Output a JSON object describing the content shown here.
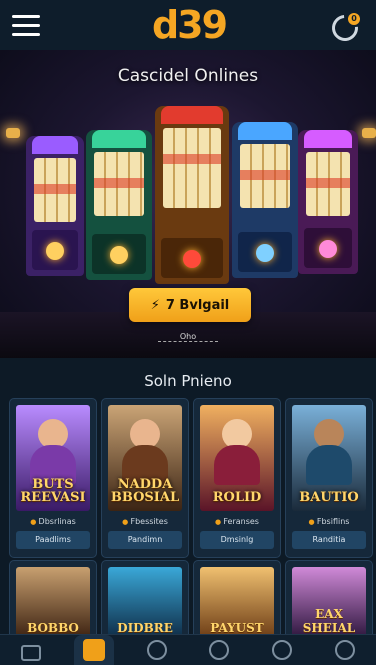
{
  "header": {
    "logo": "d39",
    "refresh_badge": "0",
    "menu_icon": "hamburger-menu-icon",
    "refresh_icon": "refresh-icon"
  },
  "hero": {
    "title": "Cascidel Onlines",
    "cta_label": "7 Bvlgail",
    "cta_icon": "slot-lever-icon",
    "note": "Oho"
  },
  "featured": {
    "title": "Soln Pnieno",
    "games": [
      {
        "caption": "BUTS REEVASI",
        "provider": "Dbsrlinas",
        "play_label": "Paadlims",
        "accent": "#7a3aa8"
      },
      {
        "caption": "NADDA BBOSIAL",
        "provider": "Fbessites",
        "play_label": "Pandimn",
        "accent": "#6b3a1e"
      },
      {
        "caption": "ROLID",
        "provider": "Feranses",
        "play_label": "Dmsinlg",
        "accent": "#8a1e3a"
      },
      {
        "caption": "BAUTIO",
        "provider": "Fbsiflins",
        "play_label": "Randitia",
        "accent": "#1e4a6b"
      }
    ],
    "games_row2": [
      {
        "caption": "BOBBO",
        "accent": "#5a3418"
      },
      {
        "caption": "DIDBRE",
        "accent": "#0e3a5a"
      },
      {
        "caption": "PAYUST",
        "accent": "#7a4a1a"
      },
      {
        "caption": "EAX SHEIAL",
        "accent": "#4a2a6b"
      }
    ]
  },
  "nav": {
    "items": [
      {
        "icon": "lock-icon",
        "active": false
      },
      {
        "icon": "home-icon",
        "active": true
      },
      {
        "icon": "casino-chip-icon",
        "active": false
      },
      {
        "icon": "gift-icon",
        "active": false
      },
      {
        "icon": "support-icon",
        "active": false
      },
      {
        "icon": "profile-icon",
        "active": false
      }
    ]
  },
  "colors": {
    "accent": "#f0a019",
    "background": "#0d1a26",
    "card": "#15283a"
  }
}
